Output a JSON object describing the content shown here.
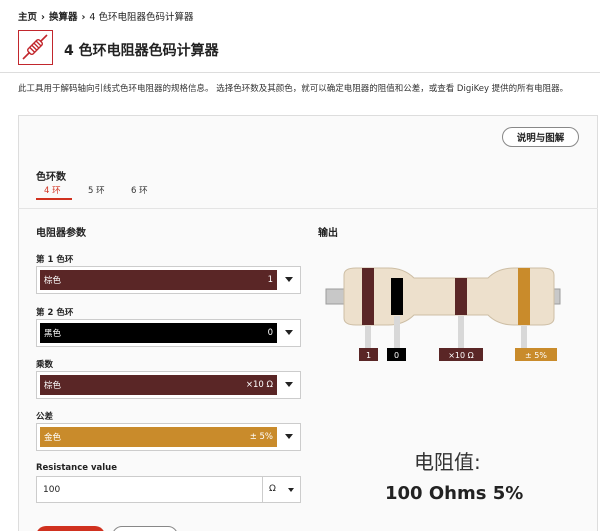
{
  "breadcrumb": [
    "主页",
    "换算器",
    "4 色环电阻器色码计算器"
  ],
  "page_title": "4 色环电阻器色码计算器",
  "intro": "此工具用于解码轴向引线式色环电阻器的规格信息。 选择色环数及其颜色，就可以确定电阻器的阻值和公差，或查看 DigiKey 提供的所有电阻器。",
  "help_button": "说明与图解",
  "band_count": {
    "label": "色环数",
    "tabs": [
      {
        "label": "4 环",
        "active": true
      },
      {
        "label": "5 环",
        "active": false
      },
      {
        "label": "6 环",
        "active": false
      }
    ]
  },
  "params": {
    "title": "电阻器参数",
    "bands": [
      {
        "label": "第 1 色环",
        "color_name": "棕色",
        "value": "1",
        "color": "#5a2626"
      },
      {
        "label": "第 2 色环",
        "color_name": "黑色",
        "value": "0",
        "color": "#000000"
      },
      {
        "label": "乘数",
        "color_name": "棕色",
        "value": "×10 Ω",
        "color": "#5a2626"
      },
      {
        "label": "公差",
        "color_name": "金色",
        "value": "± 5%",
        "color": "#c98b2b"
      }
    ],
    "resistance_label": "Resistance value",
    "resistance_value": "100",
    "unit": "Ω"
  },
  "output": {
    "title": "输出",
    "tags": [
      "1",
      "0",
      "×10 Ω",
      "± 5%"
    ],
    "result_label": "电阻值:",
    "result_value": "100 Ohms 5%"
  },
  "colors": {
    "accent": "#d0311f",
    "body": "#ede0cc",
    "brown": "#5a2626",
    "gold": "#c98b2b"
  }
}
